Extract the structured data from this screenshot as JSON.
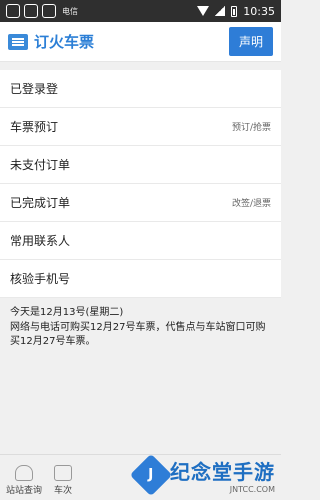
{
  "status": {
    "time": "10:35",
    "carrier": "电信"
  },
  "app": {
    "title": "订火车票",
    "action": "声明"
  },
  "login": "已登录登",
  "menu": [
    {
      "label": "车票预订",
      "sub": "预订/抢票"
    },
    {
      "label": "未支付订单",
      "sub": ""
    },
    {
      "label": "已完成订单",
      "sub": "改签/退票"
    },
    {
      "label": "常用联系人",
      "sub": ""
    },
    {
      "label": "核验手机号",
      "sub": ""
    }
  ],
  "notice": {
    "line1": "今天是12月13号(星期二)",
    "line2": "网络与电话可购买12月27号车票，代售点与车站窗口可购买12月27号车票。"
  },
  "bottom_nav": [
    {
      "label": "站站查询",
      "icon": "train-icon"
    },
    {
      "label": "车次",
      "icon": "list-icon"
    }
  ],
  "watermark": {
    "text": "纪念堂手游",
    "sub": "JNTCC.COM",
    "mark": "J"
  }
}
